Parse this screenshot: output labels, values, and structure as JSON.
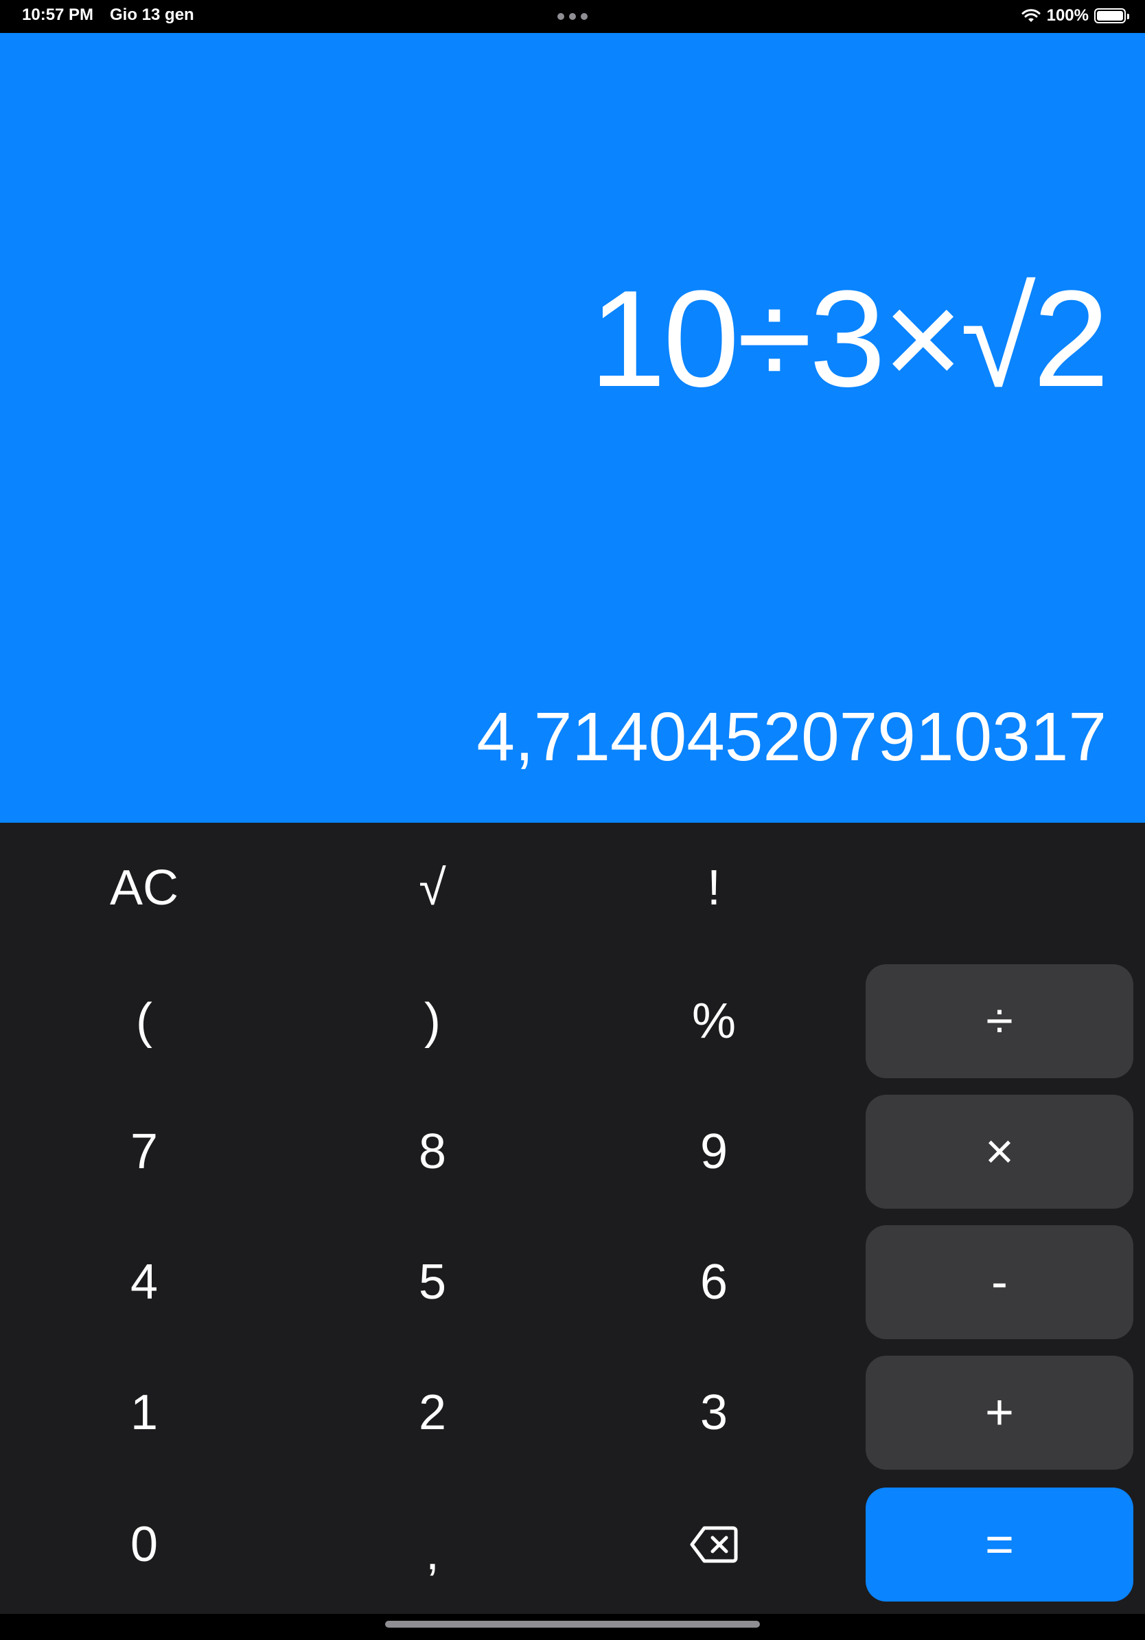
{
  "status_bar": {
    "time": "10:57 PM",
    "date": "Gio 13 gen",
    "battery": "100%",
    "icons": [
      "more-dots-icon",
      "wifi-icon",
      "battery-icon"
    ]
  },
  "display": {
    "expression": "10÷3×√2",
    "result": "4,714045207910317"
  },
  "keys": {
    "ac": "AC",
    "sqrt": "√",
    "factorial": "!",
    "open_paren": "(",
    "close_paren": ")",
    "percent": "%",
    "divide": "÷",
    "seven": "7",
    "eight": "8",
    "nine": "9",
    "multiply": "×",
    "four": "4",
    "five": "5",
    "six": "6",
    "minus": "-",
    "one": "1",
    "two": "2",
    "three": "3",
    "plus": "+",
    "zero": "0",
    "comma": ",",
    "backspace_icon": "backspace-icon",
    "equals": "="
  },
  "colors": {
    "display_background": "#0a84ff",
    "keypad_background": "#1c1c1e",
    "operator_key": "#3a3a3c",
    "equals_key": "#0a84ff",
    "text": "#ffffff"
  }
}
